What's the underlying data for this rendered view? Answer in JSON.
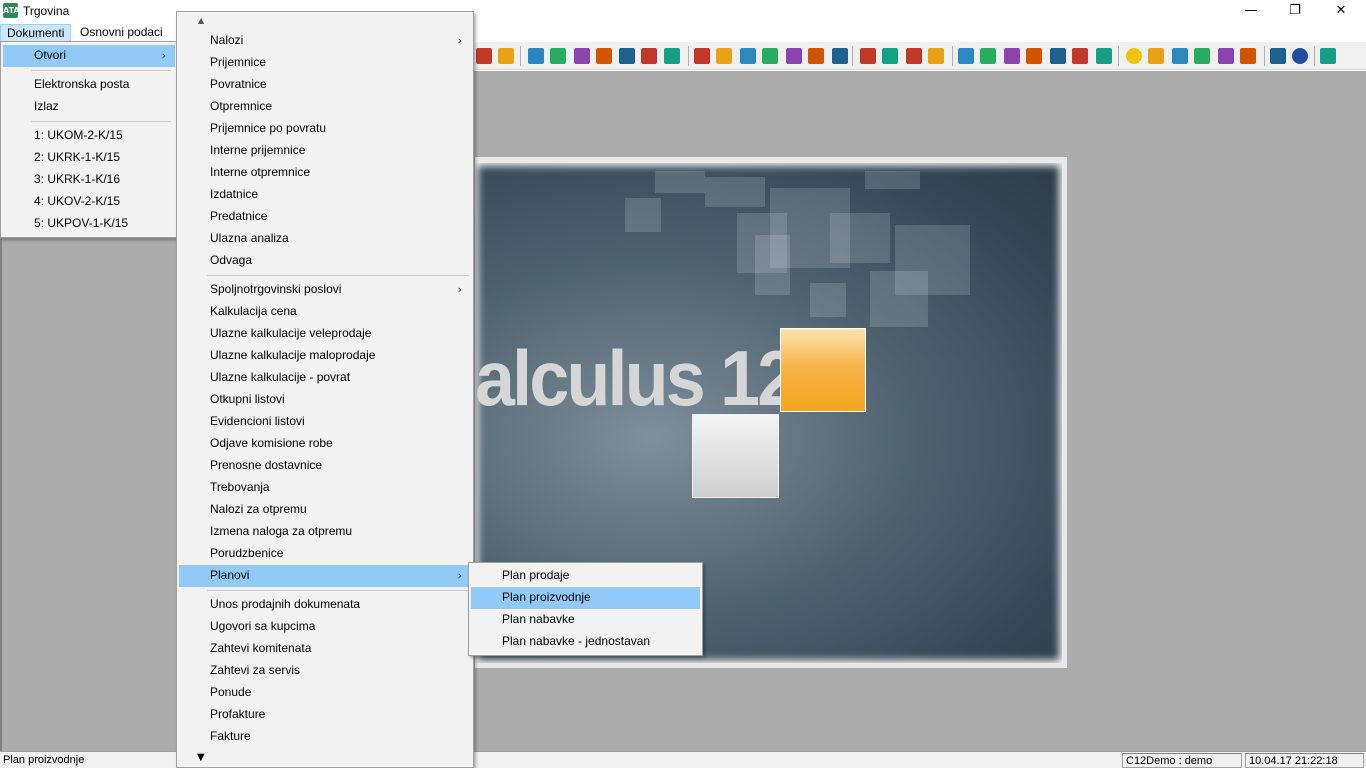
{
  "window": {
    "icon_text": "ATA",
    "title": "Trgovina",
    "minimize_glyph": "—",
    "restore_glyph": "❐",
    "close_glyph": "✕"
  },
  "menubar": {
    "items": [
      "Dokumenti",
      "Osnovni podaci"
    ]
  },
  "dokumenti_menu": {
    "items": [
      {
        "label": "Otvori",
        "has_submenu": true,
        "highlighted": true
      },
      {
        "label": "Elektronska posta"
      },
      {
        "label": "Izlaz"
      },
      {
        "label": "1: UKOM-2-K/15"
      },
      {
        "label": "2: UKRK-1-K/15"
      },
      {
        "label": "3: UKRK-1-K/16"
      },
      {
        "label": "4: UKOV-2-K/15"
      },
      {
        "label": "5: UKPOV-1-K/15"
      }
    ]
  },
  "otvori_menu": {
    "scroll_up_glyph": "▲",
    "scroll_down_glyph": "▼",
    "arrow_glyph": "›",
    "items": [
      "Nalozi",
      "Prijemnice",
      "Povratnice",
      "Otpremnice",
      "Prijemnice po povratu",
      "Interne prijemnice",
      "Interne otpremnice",
      "Izdatnice",
      "Predatnice",
      "Ulazna analiza",
      "Odvaga",
      "Spoljnotrgovinski poslovi",
      "Kalkulacija cena",
      "Ulazne kalkulacije veleprodaje",
      "Ulazne kalkulacije maloprodaje",
      "Ulazne kalkulacije - povrat",
      "Otkupni listovi",
      "Evidencioni listovi",
      "Odjave komisione robe",
      "Prenosne dostavnice",
      "Trebovanja",
      "Nalozi za otpremu",
      "Izmena naloga za otpremu",
      "Porudzbenice",
      "Planovi",
      "Unos prodajnih dokumenata",
      "Ugovori sa kupcima",
      "Zahtevi komitenata",
      "Zahtevi za servis",
      "Ponude",
      "Profakture",
      "Fakture"
    ],
    "submenu_items": [
      "Nalozi",
      "Spoljnotrgovinski poslovi",
      "Planovi"
    ],
    "highlighted": "Planovi"
  },
  "planovi_menu": {
    "items": [
      "Plan prodaje",
      "Plan proizvodnje",
      "Plan nabavke",
      "Plan nabavke - jednostavan"
    ],
    "highlighted": "Plan proizvodnje"
  },
  "splash": {
    "logo_text": "alculus 12"
  },
  "statusbar": {
    "hint": "Plan proizvodnje",
    "user": "C12Demo : demo",
    "datetime": "10.04.17 21:22:18"
  },
  "colors": {
    "menu_highlight": "#91c9f7",
    "menubar_active": "#cce8ff",
    "workspace": "#ababab",
    "splash_orange": "#f4a51c"
  },
  "toolbar_icons": [
    "check-icon",
    "star-icon",
    "doc-red-icon",
    "doc-in-icon",
    "doc-out-icon",
    "doc-back-icon",
    "doc-fwd-icon",
    "arrow-right-icon",
    "arrow-left-icon",
    "envelope-icon",
    "pencil-icon",
    "doc-edit-icon",
    "doc-delete-icon",
    "disk-icon",
    "disk-green-icon",
    "doc-blue-icon",
    "folder-icon",
    "doc-alert-icon",
    "tree-icon",
    "grid-icon",
    "window-icon",
    "layout-icon",
    "copy-icon",
    "report-icon",
    "chart-icon",
    "table-icon",
    "calc-icon",
    "bulb-icon",
    "gear-icon",
    "tag-icon",
    "stack-icon",
    "money-icon",
    "heart-icon",
    "export-icon",
    "help-icon",
    "exit-icon"
  ]
}
